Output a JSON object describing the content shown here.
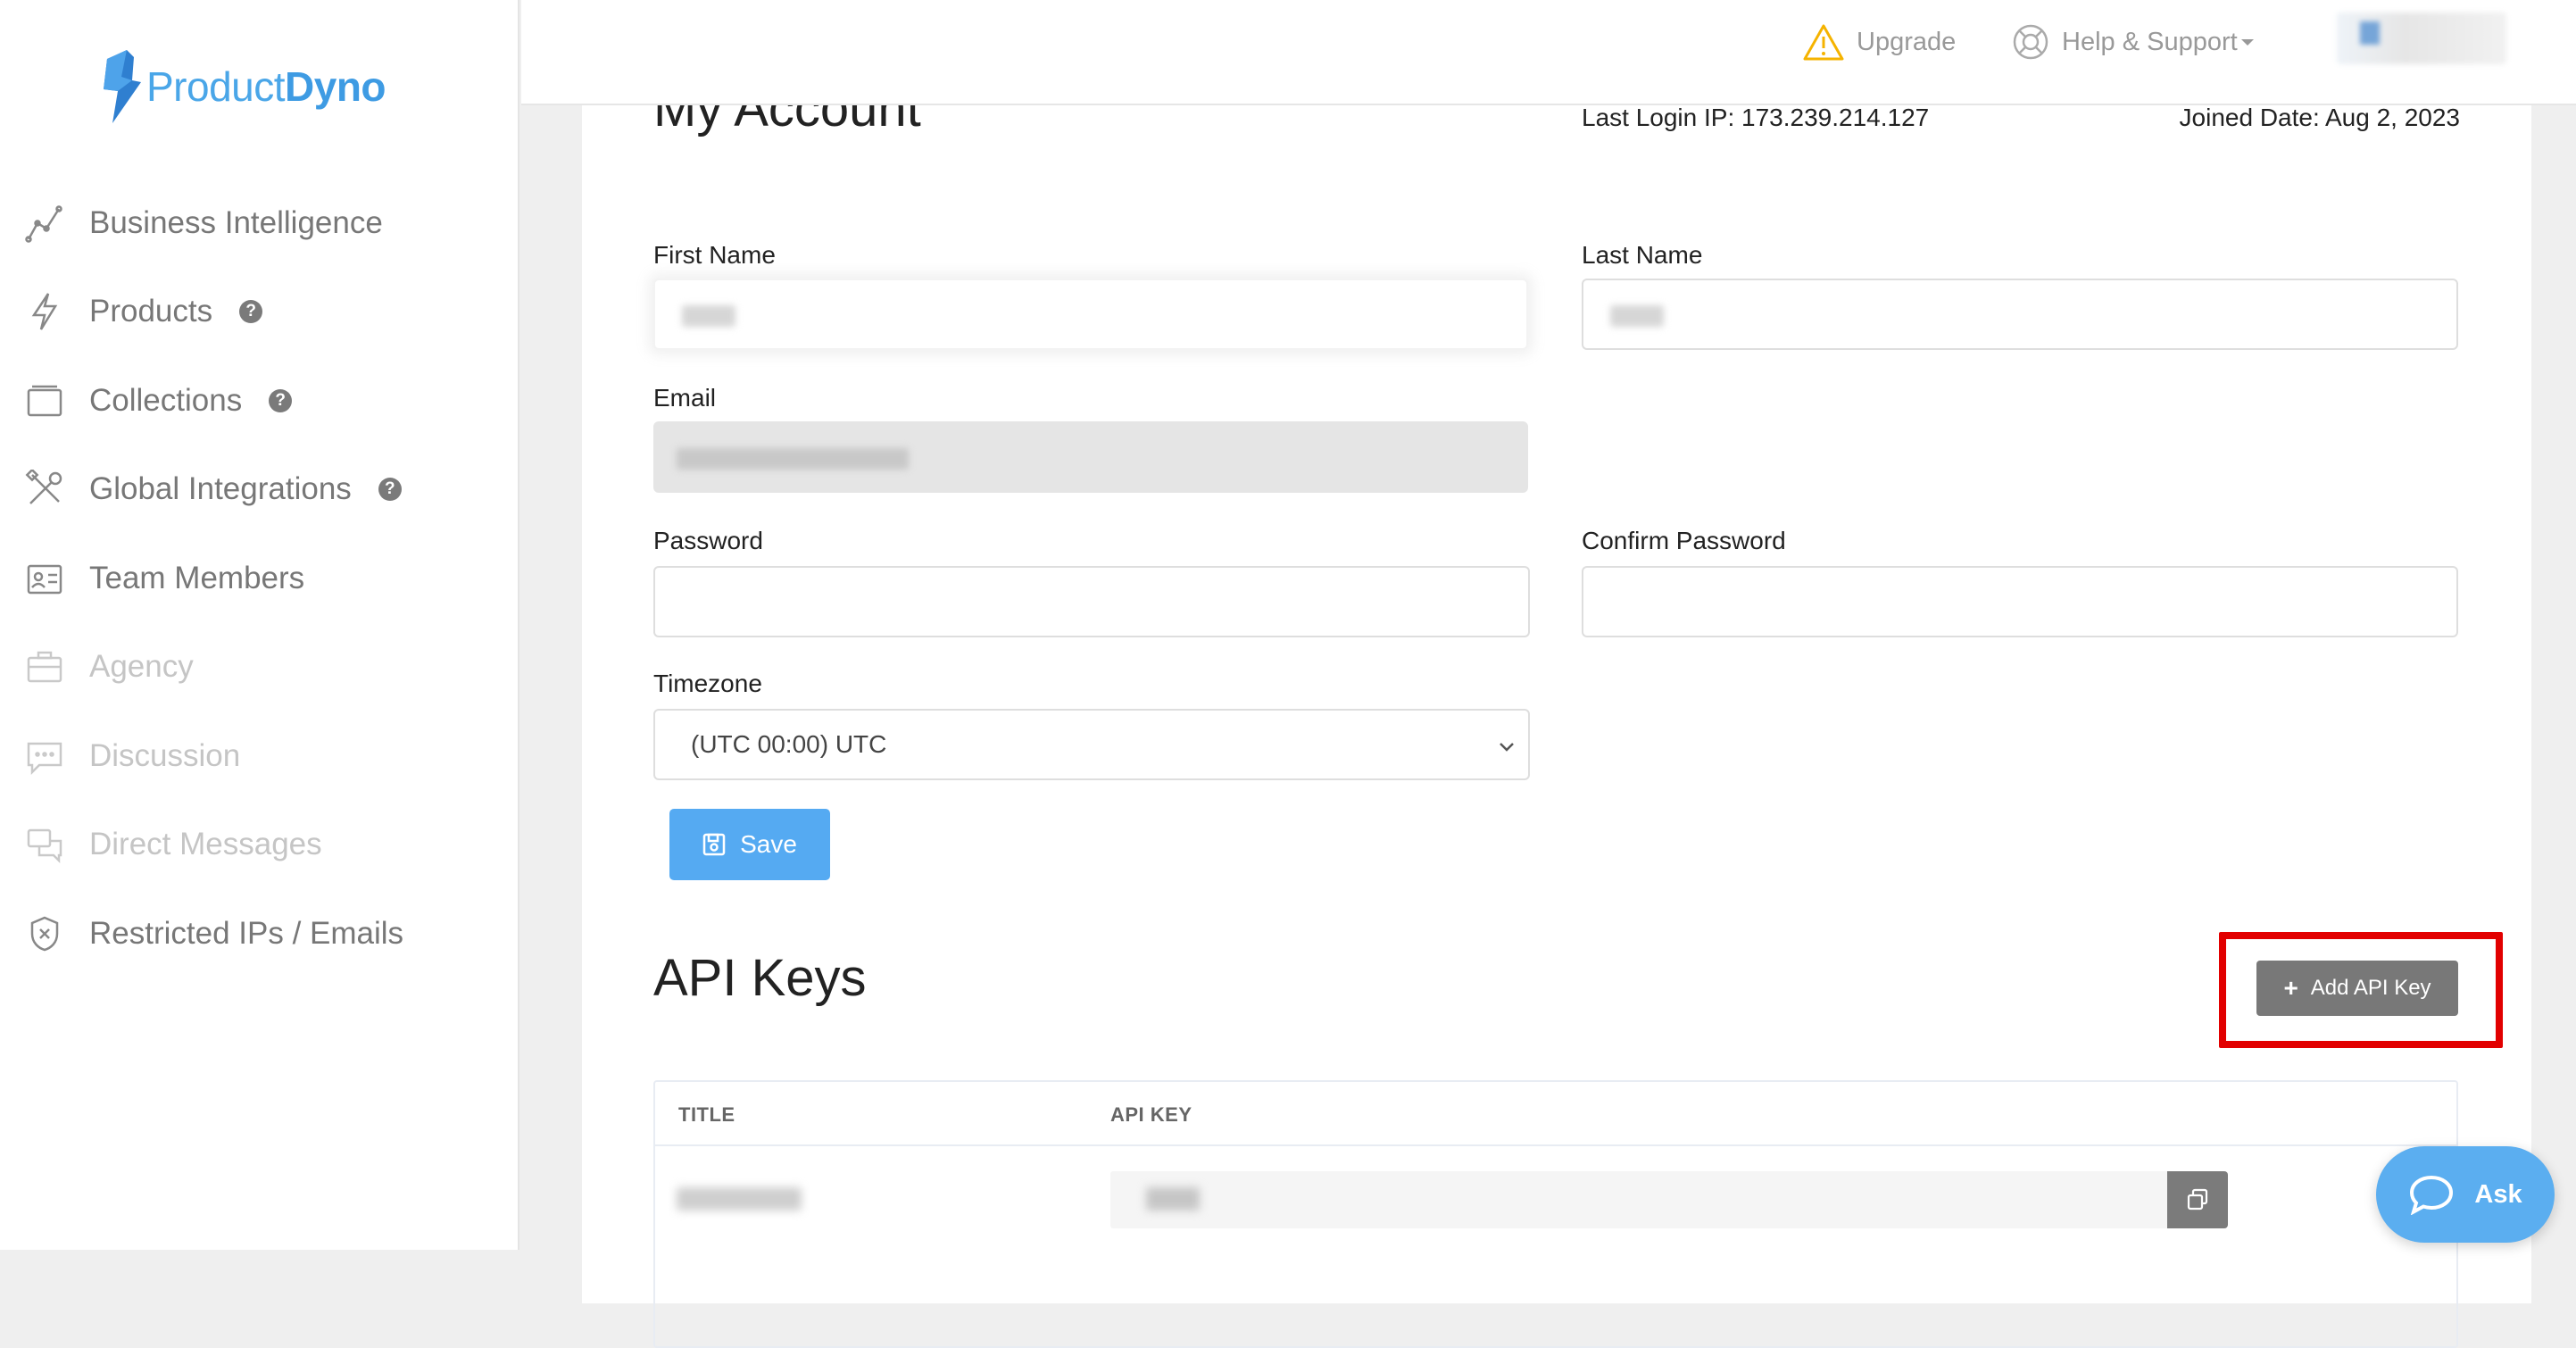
{
  "brand": {
    "name_light": "Product",
    "name_bold": "Dyno",
    "accent": "#3e9be3"
  },
  "sidebar": {
    "items": [
      {
        "label": "Business Intelligence",
        "icon": "chart-line-icon",
        "help": false,
        "dim": false
      },
      {
        "label": "Products",
        "icon": "bolt-icon",
        "help": true,
        "dim": false
      },
      {
        "label": "Collections",
        "icon": "folder-icon",
        "help": true,
        "dim": false
      },
      {
        "label": "Global Integrations",
        "icon": "tools-icon",
        "help": true,
        "dim": false
      },
      {
        "label": "Team Members",
        "icon": "id-card-icon",
        "help": false,
        "dim": false
      },
      {
        "label": "Agency",
        "icon": "briefcase-icon",
        "help": false,
        "dim": true
      },
      {
        "label": "Discussion",
        "icon": "chat-icon",
        "help": false,
        "dim": true
      },
      {
        "label": "Direct Messages",
        "icon": "messages-icon",
        "help": false,
        "dim": true
      },
      {
        "label": "Restricted IPs / Emails",
        "icon": "shield-icon",
        "help": false,
        "dim": false
      }
    ],
    "help_glyph": "?"
  },
  "topbar": {
    "upgrade_label": "Upgrade",
    "support_label": "Help & Support",
    "warning_color": "#f5b300"
  },
  "account": {
    "title": "My Account",
    "last_login": "Last Login IP: 173.239.214.127",
    "joined": "Joined Date: Aug 2, 2023",
    "first_name_label": "First Name",
    "last_name_label": "Last Name",
    "email_label": "Email",
    "password_label": "Password",
    "confirm_password_label": "Confirm Password",
    "timezone_label": "Timezone",
    "timezone_value": "(UTC 00:00) UTC",
    "save_label": "Save"
  },
  "api_keys": {
    "title": "API Keys",
    "add_label": "Add API Key",
    "columns": [
      "TITLE",
      "API KEY"
    ],
    "highlight_color": "#e20000"
  },
  "chat": {
    "ask_label": "Ask"
  }
}
